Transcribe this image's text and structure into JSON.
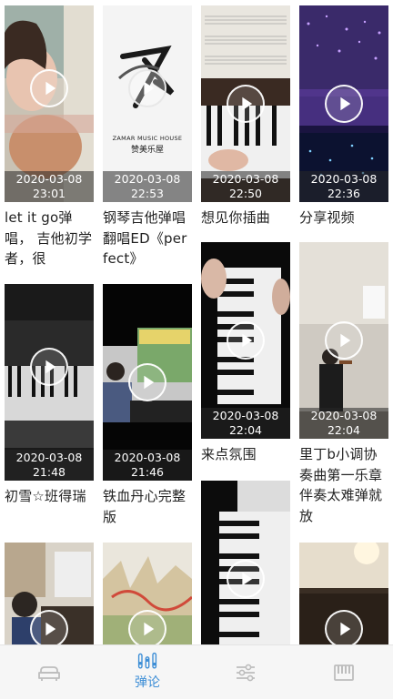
{
  "videos": [
    {
      "date": "2020-03-08",
      "time": "23:01",
      "title": "let it go弹唱， 吉他初学者，很"
    },
    {
      "date": "2020-03-08",
      "time": "22:53",
      "title": "钢琴吉他弹唱翻唱ED《perfect》",
      "logo_brand": "ZAMAR MUSIC HOUSE",
      "logo_cn": "赞美乐屋"
    },
    {
      "date": "2020-03-08",
      "time": "22:50",
      "title": "想见你插曲"
    },
    {
      "date": "2020-03-08",
      "time": "22:36",
      "title": "分享视频"
    },
    {
      "date": "2020-03-08",
      "time": "21:48",
      "title": "初雪☆班得瑞"
    },
    {
      "date": "2020-03-08",
      "time": "21:46",
      "title": "铁血丹心完整版"
    },
    {
      "date": "2020-03-08",
      "time": "22:04",
      "title": "来点氛围"
    },
    {
      "date": "2020-03-08",
      "time": "22:04",
      "title": "里丁b小调协奏曲第一乐章 伴奏太难弹就放"
    }
  ],
  "tabbar": {
    "active_label": "弹论",
    "accent_color": "#3d8ed6",
    "inactive_color": "#bdbdbd",
    "icons": [
      "sofa-icon",
      "equalizer-icon",
      "sliders-icon",
      "piano-keys-icon"
    ]
  }
}
